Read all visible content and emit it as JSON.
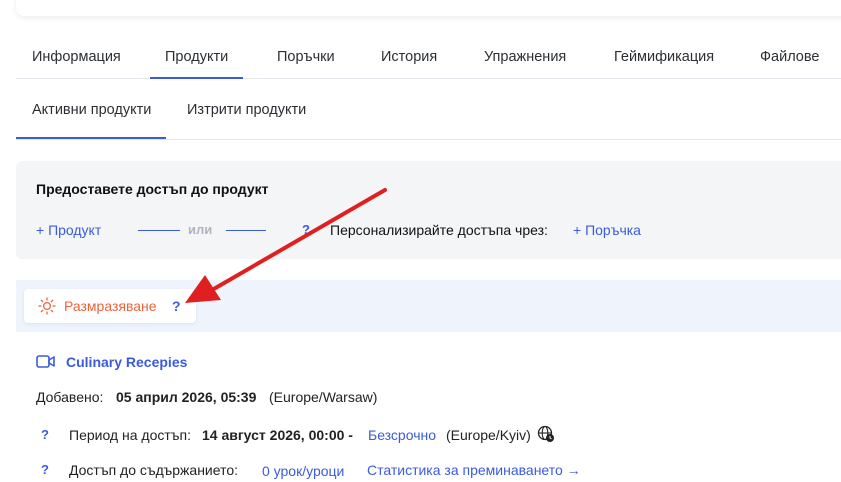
{
  "tabs": [
    {
      "label": "Информация"
    },
    {
      "label": "Продукти"
    },
    {
      "label": "Поръчки"
    },
    {
      "label": "История"
    },
    {
      "label": "Упражнения"
    },
    {
      "label": "Геймификация"
    },
    {
      "label": "Файлове"
    }
  ],
  "active_tab": "Продукти",
  "subtabs": [
    {
      "label": "Активни продукти"
    },
    {
      "label": "Изтрити продукти"
    }
  ],
  "access": {
    "title": "Предоставете достъп до продукт",
    "add_product": "+ Продукт",
    "or_text": "или",
    "help": "?",
    "personalize_label": "Персонализирайте достъпа чрез:",
    "add_order": "+ Поръчка"
  },
  "freeze": {
    "label": "Размразяване",
    "help": "?"
  },
  "product": {
    "name": "Culinary Recepies",
    "added_label": "Добавено:",
    "added_value": "05 април 2026, 05:39",
    "added_tz": "(Europe/Warsaw)",
    "period_help": "?",
    "period_label": "Период на достъп:",
    "period_start": "14 август 2026, 00:00 -",
    "period_end": "Безсрочно",
    "period_tz": "(Europe/Kyiv)",
    "content_help": "?",
    "content_label": "Достъп до съдържанието:",
    "lessons_link": "0 урок/уроци",
    "stats_link": "Статистика за преминаването →"
  },
  "colors": {
    "accent": "#3b5bdb",
    "freeze_orange": "#e8653a",
    "arrow_red": "#e02020"
  }
}
